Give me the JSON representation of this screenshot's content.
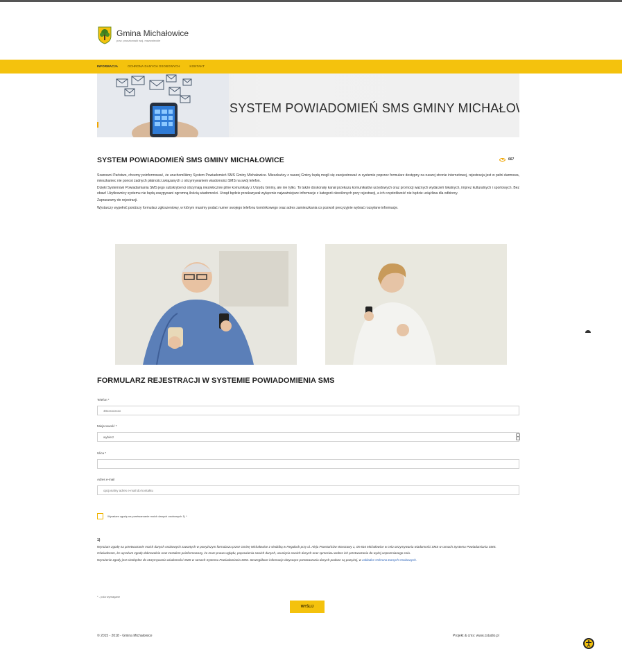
{
  "header": {
    "site_title": "Gmina Michałowice",
    "site_subtitle": "pow. pruszkowski woj. mazowieckie"
  },
  "nav": {
    "items": [
      "INFORMACJA",
      "OCHRONA DANYCH OSOBOWYCH",
      "KONTAKT"
    ],
    "active": "INFORMACJA"
  },
  "banner": {
    "text": "SYSTEM POWIADOMIEŃ SMS GMINY MICHAŁOWICE"
  },
  "article": {
    "title": "SYSTEM POWIADOMIEŃ SMS GMINY MICHAŁOWICE",
    "views": "667",
    "paragraphs": [
      "Szanowni Państwo, chcemy poinformować, że uruchomiliśmy System Powiadomień SMS Gminy Michałowice. Mieszkańcy z naszej Gminy będą mogli się zarejestrować w systemie poprzez formularz dostępny na naszej stronie internetowej, rejestracja jest w pełni darmowa, mieszkaniec nie ponosi żadnych płatności związanych z otrzymywaniem wiadomości SMS na swój telefon.",
      "Dzięki Systemowi Powiadamiania SMS jego subskrybenci otrzymają niezwłocznie pilne komunikaty z Urzędu Gminy, ale nie tylko. To także doskonały kanał przekazu komunikatów urzędowych oraz promocji ważnych wydarzeń lokalnych, imprez kulturalnych i sportowych. Bez obaw! Użytkownicy systemu nie będą zasypywani ogromną ilością wiadomości. Urząd będzie przekazywał wyłącznie najważniejsze informacje z kategorii określonych przy rejestracji, a ich częstotliwość nie będzie uciążliwa dla odbiorcy.",
      "Zapraszamy do rejestracji.",
      "Wystarczy wypełnić poniższy formularz zgłoszeniowy, w którym musimy podać numer swojego telefonu komórkowego oraz adres zamieszkania co pozwoli precyzyjnie wybrać rozsyłane informacje."
    ]
  },
  "form": {
    "title": "FORMULARZ REJESTRACJI W SYSTEMIE POWIADOMIENIA SMS",
    "phone_label": "Telefon *",
    "phone_placeholder": "48xxxxxxxxx",
    "city_label": "Miejscowość *",
    "city_value": "wybierz",
    "street_label": "Ulica *",
    "street_value": "",
    "email_label": "Adres e-mail",
    "email_placeholder": "opcjonalny adres e-mail do kontaktu",
    "consent_label": "Wyrażam zgodę na przetwarzanie moich danych osobowych 1) *",
    "legal_mark": "1)",
    "legal_p1": "Wyrażam zgodę na przetwarzanie moich danych osobowych zawartych w powyższym formularzu przez Gminę Michałowice z siedzibą w Regułach przy ul. Aleja Powstańców Warszawy 1, 05-816 Michałowice w celu otrzymywania wiadomości SMS w ramach Systemu Powiadamiania SMS.",
    "legal_p2": "Oświadczam, że wyrażam zgodę dobrowolnie oraz zostałem poinformowany, że mam prawo wglądu, poprawienia swoich danych, usunięcia swoich danych oraz sprzeciwu wobec ich przetwarzania do wyżej wspomnianego celu.",
    "legal_p3": "Wyrażenie zgody jest niezbędne do otrzymywania wiadomości SMS w ramach Systemu Powiadamiania SMS. Szczegółowe informacje dotyczące przetwarzania danych podane są powyżej, w",
    "legal_link": "zakładce Ochrona Danych Osobowych.",
    "required_note": "* - pola wymagane",
    "submit_label": "WYŚLIJ"
  },
  "footer": {
    "copyright": "© 2015 - 2018 - Gmina Michałowice",
    "credit": "Projekt & cms: www.zstudio.pl"
  },
  "icons": {
    "views": "eye-icon",
    "accessibility": "accessibility-icon",
    "crest": "crest-icon"
  },
  "colors": {
    "accent": "#f4c20d",
    "link": "#2a62b8"
  }
}
